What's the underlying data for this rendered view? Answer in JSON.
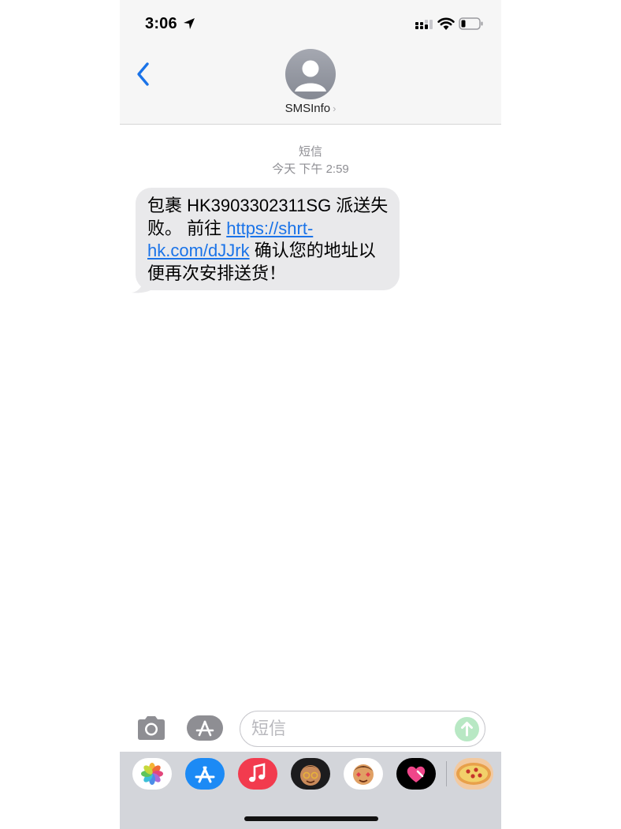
{
  "status_bar": {
    "time": "3:06",
    "icons": [
      "location-arrow-icon",
      "cellular-signal-icon",
      "wifi-icon",
      "battery-icon"
    ]
  },
  "nav": {
    "back_icon": "chevron-left-icon",
    "contact_name": "SMSInfo",
    "contact_chevron": "›"
  },
  "thread": {
    "label": "短信",
    "timestamp": "今天 下午 2:59"
  },
  "message": {
    "text_before": "包裹 HK3903302311SG 派送失败。 前往 ",
    "link": "https://shrt-hk.com/dJJrk",
    "text_after": " 确认您的地址以便再次安排送货！"
  },
  "composer": {
    "placeholder": "短信",
    "camera_icon": "camera-icon",
    "apps_icon": "app-store-icon",
    "send_icon": "arrow-up-icon"
  },
  "app_drawer": {
    "apps": [
      "photos-app",
      "app-store-app",
      "music-app",
      "memoji-app",
      "animoji-app",
      "digital-touch-app",
      "game-app"
    ]
  },
  "colors": {
    "accent": "#1a73e8",
    "bubble": "#e9e9eb",
    "header": "#f6f6f6",
    "drawer": "#d3d5da"
  }
}
